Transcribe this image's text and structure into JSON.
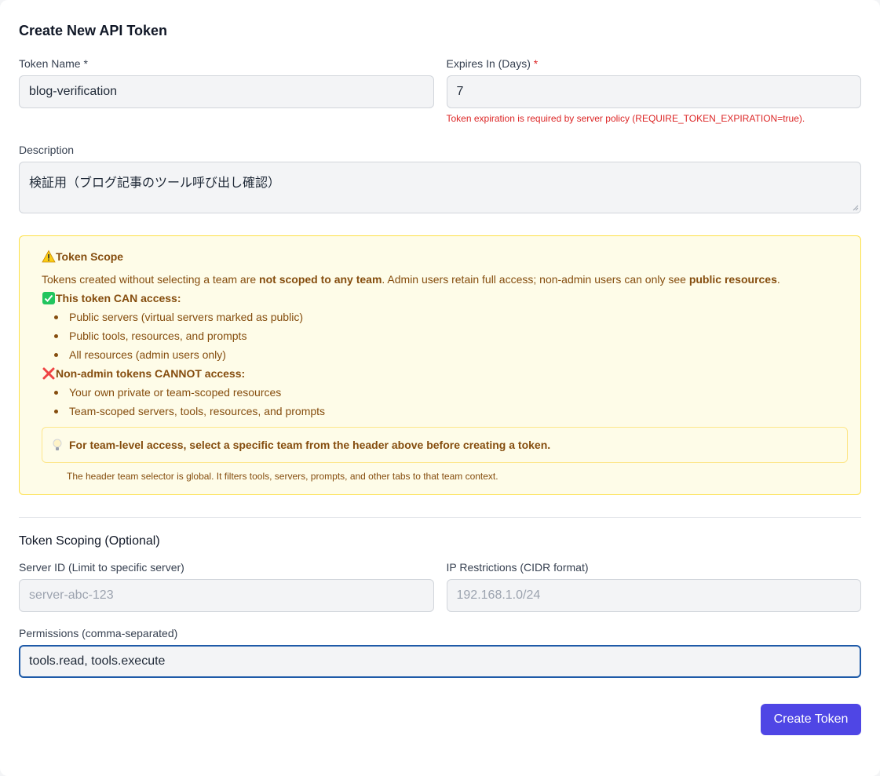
{
  "form": {
    "title": "Create New API Token",
    "token_name": {
      "label": "Token Name *",
      "value": "blog-verification"
    },
    "expires": {
      "label": "Expires In (Days)",
      "required_mark": "*",
      "value": "7",
      "error": "Token expiration is required by server policy (REQUIRE_TOKEN_EXPIRATION=true)."
    },
    "description": {
      "label": "Description",
      "value": "検証用（ブログ記事のツール呼び出し確認）"
    }
  },
  "scope": {
    "title": "Token Scope",
    "intro_1": "Tokens created without selecting a team are ",
    "intro_bold_1": "not scoped to any team",
    "intro_2": ". Admin users retain full access; non-admin users can only see ",
    "intro_bold_2": "public resources",
    "intro_3": ".",
    "can_heading": "This token CAN access:",
    "can_items": [
      "Public servers (virtual servers marked as public)",
      "Public tools, resources, and prompts",
      "All resources (admin users only)"
    ],
    "cannot_heading": "Non-admin tokens CANNOT access:",
    "cannot_items": [
      "Your own private or team-scoped resources",
      "Team-scoped servers, tools, resources, and prompts"
    ],
    "tip": "For team-level access, select a specific team from the header above before creating a token.",
    "tip_note": "The header team selector is global. It filters tools, servers, prompts, and other tabs to that team context."
  },
  "scoping": {
    "title": "Token Scoping (Optional)",
    "server_id": {
      "label": "Server ID (Limit to specific server)",
      "placeholder": "server-abc-123"
    },
    "ip": {
      "label": "IP Restrictions (CIDR format)",
      "placeholder": "192.168.1.0/24"
    },
    "permissions": {
      "label": "Permissions (comma-separated)",
      "value": "tools.read, tools.execute"
    }
  },
  "actions": {
    "create_label": "Create Token"
  },
  "colors": {
    "accent": "#4f46e5",
    "error": "#dc2626",
    "warning_text": "#854d0e",
    "warning_bg": "#fefce8",
    "focus": "#1e5aa8"
  },
  "icons": {
    "scope": "warning-icon",
    "can": "check-icon",
    "cannot": "cross-icon",
    "tip": "lightbulb-icon"
  }
}
